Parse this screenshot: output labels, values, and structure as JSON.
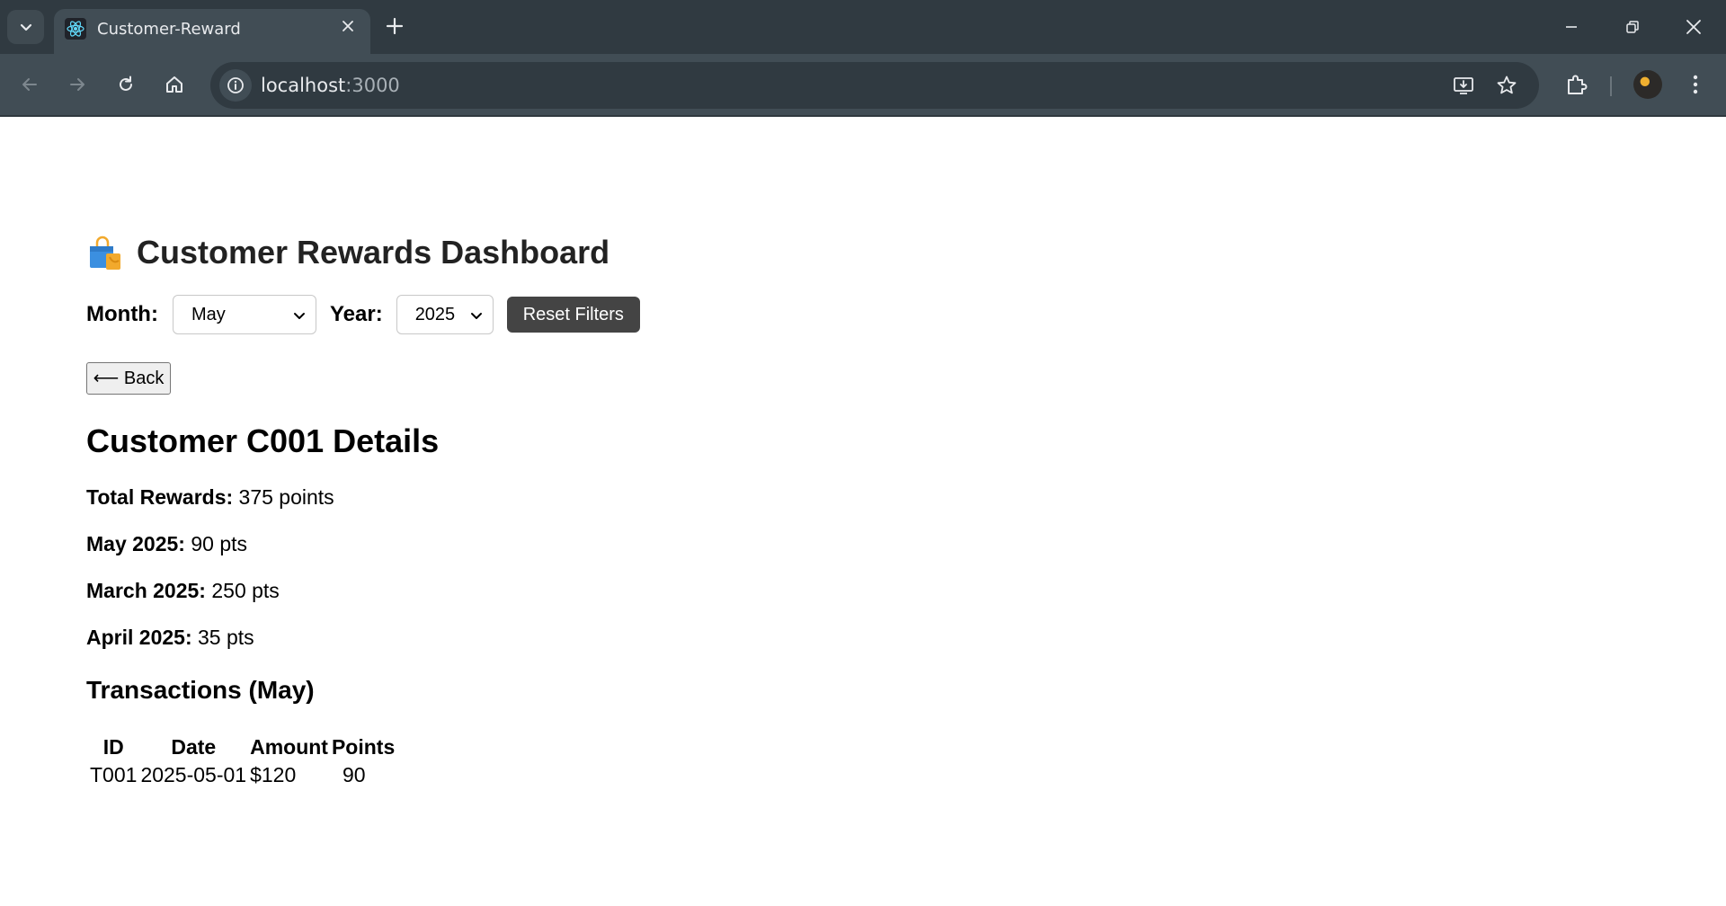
{
  "browser": {
    "tab_title": "Customer-Reward",
    "url_host": "localhost",
    "url_port": ":3000"
  },
  "dashboard": {
    "title": "Customer Rewards Dashboard",
    "icon": "shopping-bag-icon",
    "filters": {
      "month_label": "Month:",
      "month_value": "May",
      "year_label": "Year:",
      "year_value": "2025",
      "reset_label": "Reset Filters"
    }
  },
  "back_label": "⟵ Back",
  "customer": {
    "title": "Customer C001 Details",
    "stats": [
      {
        "label": "Total Rewards:",
        "value": "375 points"
      },
      {
        "label": "May 2025:",
        "value": "90 pts"
      },
      {
        "label": "March 2025:",
        "value": "250 pts"
      },
      {
        "label": "April 2025:",
        "value": "35 pts"
      }
    ]
  },
  "transactions": {
    "title": "Transactions (May)",
    "headers": [
      "ID",
      "Date",
      "Amount",
      "Points"
    ],
    "rows": [
      [
        "T001",
        "2025-05-01",
        "$120",
        "90"
      ]
    ]
  },
  "colors": {
    "chrome_dark": "#303a41",
    "chrome_mid": "#414d55",
    "reset_button": "#444444"
  }
}
